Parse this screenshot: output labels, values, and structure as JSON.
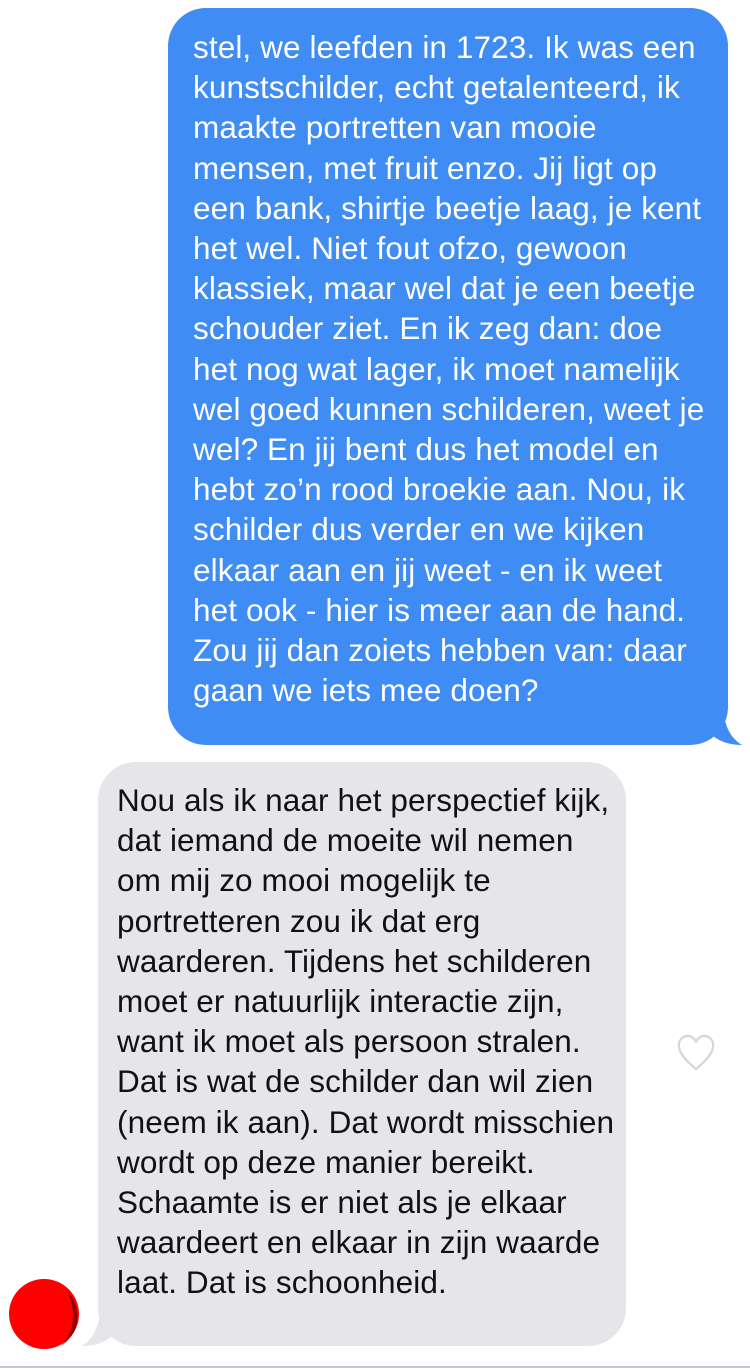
{
  "conversation": {
    "messages": [
      {
        "direction": "outgoing",
        "text": "stel, we leefden in 1723. Ik was een kunstschilder, echt getalenteerd, ik maakte portretten van mooie mensen, met fruit enzo. Jij ligt op een bank, shirtje beetje laag, je kent het wel. Niet fout ofzo, gewoon klassiek, maar wel dat je een beetje schouder ziet. En ik zeg dan: doe het nog wat lager, ik moet namelijk wel goed kunnen schilderen, weet je wel? En jij bent dus het model en hebt zo’n rood broekie aan. Nou, ik schilder dus verder en we kijken elkaar aan en jij weet - en ik weet het ook - hier is meer aan de hand. Zou jij dan zoiets hebben van: daar gaan we iets mee doen?",
        "bubble_color": "#3f8cf5"
      },
      {
        "direction": "incoming",
        "text": "Nou als ik naar het perspectief kijk, dat iemand de moeite wil nemen om mij zo mooi mogelijk te portretteren zou ik dat erg waarderen. Tijdens het schilderen moet er natuurlijk interactie zijn, want ik moet als persoon stralen. Dat is wat de schilder dan wil zien (neem ik aan). Dat wordt misschien wordt op deze manier bereikt. Schaamte is er niet als je elkaar waardeert en elkaar in zijn waarde laat. Dat is schoonheid.",
        "bubble_color": "#e5e5ea"
      }
    ],
    "reaction_icon": "heart-outline-icon",
    "avatar": {
      "icon": "avatar-redacted",
      "color": "#ff0000"
    }
  }
}
